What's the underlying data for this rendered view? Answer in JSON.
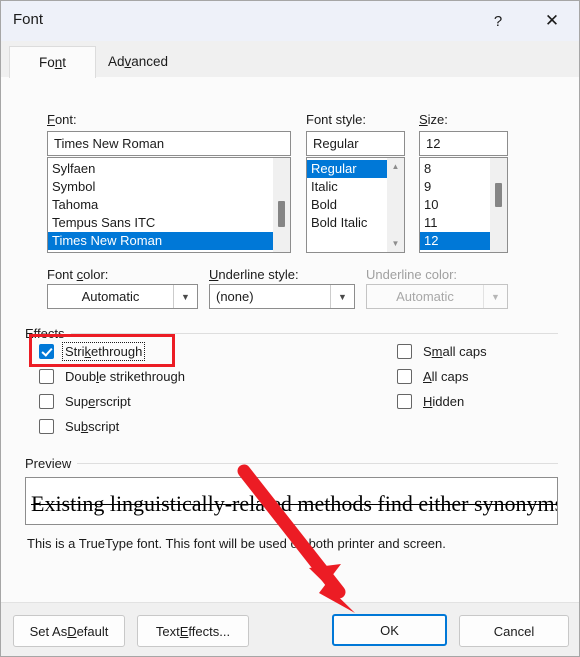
{
  "window": {
    "title": "Font",
    "help_icon": "question-mark-icon",
    "close_icon": "close-icon"
  },
  "tabs": [
    {
      "label_html": "Fo<u>n</u>t",
      "label": "Font",
      "active": true
    },
    {
      "label_html": "Ad<u>v</u>anced",
      "label": "Advanced",
      "active": false
    }
  ],
  "font_section": {
    "font_label_html": "<u>F</u>ont:",
    "font_value": "Times New Roman",
    "font_list": [
      "Sylfaen",
      "Symbol",
      "Tahoma",
      "Tempus Sans ITC",
      "Times New Roman"
    ],
    "font_selected": "Times New Roman",
    "style_label": "Font style:",
    "style_value": "Regular",
    "style_list": [
      "Regular",
      "Italic",
      "Bold",
      "Bold Italic"
    ],
    "style_selected": "Regular",
    "size_label_html": "<u>S</u>ize:",
    "size_value": "12",
    "size_list": [
      "8",
      "9",
      "10",
      "11",
      "12"
    ],
    "size_selected": "12"
  },
  "color_row": {
    "font_color_label_html": "Font <u>c</u>olor:",
    "font_color_value": "Automatic",
    "underline_style_label_html": "<u>U</u>nderline style:",
    "underline_style_value": "(none)",
    "underline_color_label": "Underline color:",
    "underline_color_value": "Automatic",
    "underline_color_disabled": true
  },
  "effects": {
    "group_label": "Effects",
    "left_column": [
      {
        "label_html": "Stri<u>k</u>ethrough",
        "label": "Strikethrough",
        "checked": true,
        "focused": true
      },
      {
        "label_html": "Doub<u>l</u>e strikethrough",
        "label": "Double strikethrough",
        "checked": false,
        "focused": false
      },
      {
        "label_html": "Sup<u>e</u>rscript",
        "label": "Superscript",
        "checked": false,
        "focused": false
      },
      {
        "label_html": "Su<u>b</u>script",
        "label": "Subscript",
        "checked": false,
        "focused": false
      }
    ],
    "right_column": [
      {
        "label_html": "S<u>m</u>all caps",
        "label": "Small caps",
        "checked": false
      },
      {
        "label_html": "<u>A</u>ll caps",
        "label": "All caps",
        "checked": false
      },
      {
        "label_html": "<u>H</u>idden",
        "label": "Hidden",
        "checked": false
      }
    ]
  },
  "preview": {
    "group_label": "Preview",
    "sample_text": "Existing linguistically-related methods find either synonyms or otl",
    "note": "This is a TrueType font. This font will be used on both printer and screen."
  },
  "footer": {
    "set_as_default_html": "Set As <u>D</u>efault",
    "set_as_default": "Set As Default",
    "text_effects_html": "Text <u>E</u>ffects...",
    "text_effects": "Text Effects...",
    "ok": "OK",
    "cancel": "Cancel"
  },
  "annotations": {
    "highlight_color": "#ec1c24",
    "arrow_color": "#ec1c24",
    "highlight_target": "Strikethrough",
    "arrow_target": "OK"
  }
}
